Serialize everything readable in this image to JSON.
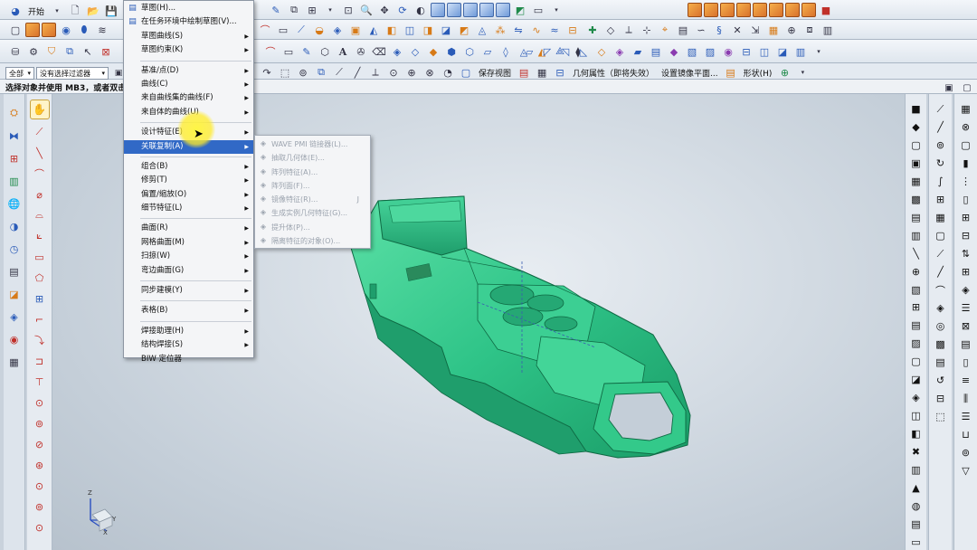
{
  "toolbar": {
    "start_label": "开始",
    "filter_label": "全部",
    "filter_combo": "没有选择过滤器",
    "save_view_label": "保存视图",
    "geom_props_label": "几何属性（即将失效）",
    "mirror_plane_label": "设置镜像平面...",
    "shape_label": "形状(H)"
  },
  "status": {
    "text": "选择对象并使用 MB3，或者双击"
  },
  "menu": {
    "items": [
      {
        "label": "草图(H)...",
        "icon": "sketch-icon",
        "submenu": false
      },
      {
        "label": "在任务环境中绘制草图(V)...",
        "icon": "sketch-task-icon",
        "submenu": false
      },
      {
        "label": "草图曲线(S)",
        "submenu": true
      },
      {
        "label": "草图约束(K)",
        "submenu": true
      },
      {
        "sep": true
      },
      {
        "label": "基准/点(D)",
        "submenu": true
      },
      {
        "label": "曲线(C)",
        "submenu": true
      },
      {
        "label": "来自曲线集的曲线(F)",
        "submenu": true
      },
      {
        "label": "来自体的曲线(U)",
        "submenu": true
      },
      {
        "sep": true
      },
      {
        "label": "设计特征(E)",
        "submenu": true
      },
      {
        "label": "关联复制(A)",
        "submenu": true,
        "highlighted": true
      },
      {
        "sep": true
      },
      {
        "label": "组合(B)",
        "submenu": true
      },
      {
        "label": "修剪(T)",
        "submenu": true
      },
      {
        "label": "偏置/缩放(O)",
        "submenu": true
      },
      {
        "label": "细节特征(L)",
        "submenu": true
      },
      {
        "sep": true
      },
      {
        "label": "曲面(R)",
        "submenu": true
      },
      {
        "label": "网格曲面(M)",
        "submenu": true
      },
      {
        "label": "扫掠(W)",
        "submenu": true
      },
      {
        "label": "弯边曲面(G)",
        "submenu": true
      },
      {
        "sep": true
      },
      {
        "label": "同步建模(Y)",
        "submenu": true
      },
      {
        "sep": true
      },
      {
        "label": "表格(B)",
        "submenu": true
      },
      {
        "sep": true
      },
      {
        "label": "焊接助理(H)",
        "submenu": true
      },
      {
        "label": "结构焊接(S)",
        "submenu": true
      },
      {
        "label": "BIW 定位器",
        "submenu": false
      }
    ]
  },
  "submenu": {
    "items": [
      {
        "label": "WAVE PMI 链接器(L)...",
        "icon": "wave-link-icon"
      },
      {
        "label": "抽取几何体(E)...",
        "icon": "extract-icon"
      },
      {
        "label": "阵列特征(A)...",
        "icon": "pattern-feature-icon"
      },
      {
        "label": "阵列面(F)...",
        "icon": "pattern-face-icon"
      },
      {
        "label": "镜像特征(R)...",
        "icon": "mirror-feature-icon",
        "key": "J"
      },
      {
        "label": "生成实例几何特征(G)...",
        "icon": "instance-geometry-icon"
      },
      {
        "label": "提升体(P)...",
        "icon": "promote-icon"
      },
      {
        "label": "隔离特征的对象(O)...",
        "icon": "isolate-icon"
      }
    ]
  },
  "axes": {
    "x": "X",
    "y": "Y",
    "z": "Z"
  },
  "colors": {
    "model_green": "#33c98a",
    "highlight": "#3169c6"
  }
}
